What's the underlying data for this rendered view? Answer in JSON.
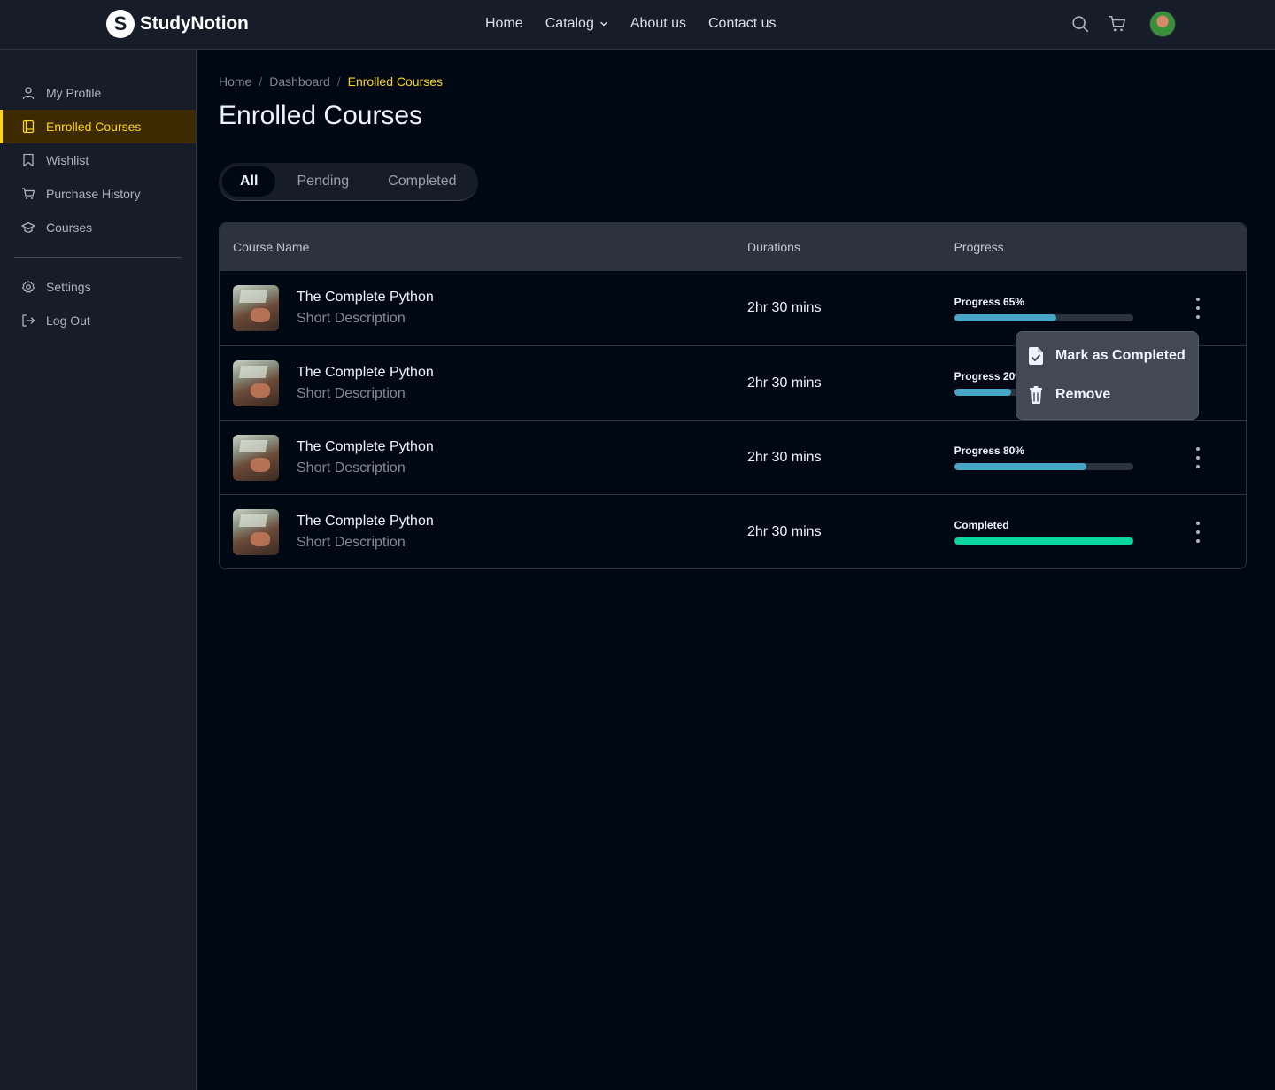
{
  "brand": {
    "logo_letter": "S",
    "name": "StudyNotion"
  },
  "nav": {
    "home": "Home",
    "catalog": "Catalog",
    "about": "About us",
    "contact": "Contact us"
  },
  "sidebar": {
    "items": [
      {
        "label": "My Profile",
        "icon": "user-icon"
      },
      {
        "label": "Enrolled Courses",
        "icon": "book-icon",
        "active": true
      },
      {
        "label": "Wishlist",
        "icon": "bookmark-icon"
      },
      {
        "label": "Purchase History",
        "icon": "cart-icon"
      },
      {
        "label": "Courses",
        "icon": "graduation-cap-icon"
      }
    ],
    "bottom": [
      {
        "label": "Settings",
        "icon": "gear-icon"
      },
      {
        "label": "Log Out",
        "icon": "logout-icon"
      }
    ]
  },
  "breadcrumb": {
    "home": "Home",
    "dashboard": "Dashboard",
    "current": "Enrolled Courses"
  },
  "page_title": "Enrolled Courses",
  "tabs": [
    {
      "label": "All",
      "active": true
    },
    {
      "label": "Pending"
    },
    {
      "label": "Completed"
    }
  ],
  "table": {
    "headers": {
      "name": "Course Name",
      "duration": "Durations",
      "progress": "Progress"
    },
    "rows": [
      {
        "title": "The Complete Python",
        "desc": "Short Description",
        "duration": "2hr 30 mins",
        "progress_label": "Progress 65%",
        "progress": 0.57
      },
      {
        "title": "The Complete Python",
        "desc": "Short Description",
        "duration": "2hr 30 mins",
        "progress_label": "Progress 20%",
        "progress": 0.32
      },
      {
        "title": "The Complete Python",
        "desc": "Short Description",
        "duration": "2hr 30 mins",
        "progress_label": "Progress 80%",
        "progress": 0.74
      },
      {
        "title": "The Complete Python",
        "desc": "Short Description",
        "duration": "2hr 30 mins",
        "progress_label": "Completed",
        "progress": 1.0
      }
    ]
  },
  "menu": {
    "mark_completed": "Mark as Completed",
    "remove": "Remove"
  },
  "colors": {
    "accent": "#FFD60A",
    "progress": "#47A5C5",
    "completed": "#06D6A0"
  }
}
